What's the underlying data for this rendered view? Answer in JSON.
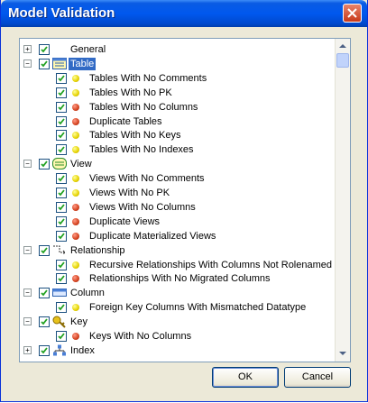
{
  "window": {
    "title": "Model Validation"
  },
  "buttons": {
    "ok": "OK",
    "cancel": "Cancel"
  },
  "tree": [
    {
      "kind": "group",
      "label": "General",
      "expander": "+",
      "icon": "none-icon"
    },
    {
      "kind": "group",
      "label": "Table",
      "expander": "−",
      "icon": "table-icon",
      "selected": true
    },
    {
      "kind": "item",
      "label": "Tables With No Comments",
      "severity": "warning"
    },
    {
      "kind": "item",
      "label": "Tables With No PK",
      "severity": "warning"
    },
    {
      "kind": "item",
      "label": "Tables With No Columns",
      "severity": "error"
    },
    {
      "kind": "item",
      "label": "Duplicate Tables",
      "severity": "error"
    },
    {
      "kind": "item",
      "label": "Tables With No Keys",
      "severity": "warning"
    },
    {
      "kind": "item",
      "label": "Tables With No Indexes",
      "severity": "warning"
    },
    {
      "kind": "group",
      "label": "View",
      "expander": "−",
      "icon": "view-icon"
    },
    {
      "kind": "item",
      "label": "Views With No Comments",
      "severity": "warning"
    },
    {
      "kind": "item",
      "label": "Views With No PK",
      "severity": "warning"
    },
    {
      "kind": "item",
      "label": "Views With No Columns",
      "severity": "error"
    },
    {
      "kind": "item",
      "label": "Duplicate Views",
      "severity": "error"
    },
    {
      "kind": "item",
      "label": "Duplicate Materialized Views",
      "severity": "error"
    },
    {
      "kind": "group",
      "label": "Relationship",
      "expander": "−",
      "icon": "relationship-icon"
    },
    {
      "kind": "item",
      "label": "Recursive Relationships With Columns Not Rolenamed",
      "severity": "warning"
    },
    {
      "kind": "item",
      "label": "Relationships With No Migrated Columns",
      "severity": "error"
    },
    {
      "kind": "group",
      "label": "Column",
      "expander": "−",
      "icon": "column-icon"
    },
    {
      "kind": "item",
      "label": "Foreign Key Columns With Mismatched Datatype",
      "severity": "warning"
    },
    {
      "kind": "group",
      "label": "Key",
      "expander": "−",
      "icon": "key-icon"
    },
    {
      "kind": "item",
      "label": "Keys With No Columns",
      "severity": "error"
    },
    {
      "kind": "group",
      "label": "Index",
      "expander": "+",
      "icon": "index-icon"
    }
  ],
  "colors": {
    "warning": "#e6d200",
    "error": "#d4421f",
    "selection": "#316ac5"
  }
}
